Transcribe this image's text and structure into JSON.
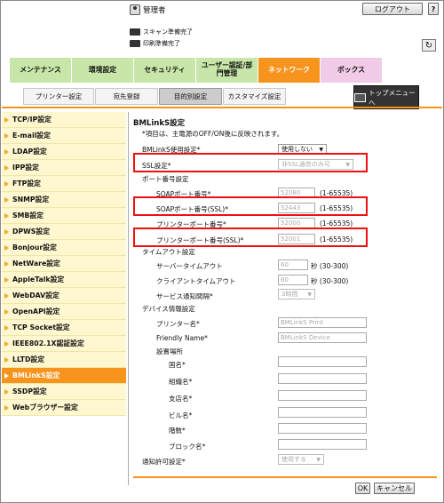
{
  "header": {
    "user": "管理者",
    "logout": "ログアウト",
    "help": "?",
    "status": [
      "スキャン準備完了",
      "印刷準備完了"
    ]
  },
  "tabs_main": [
    {
      "label": "メンテナンス",
      "color": "#c8e6a8"
    },
    {
      "label": "環境設定",
      "color": "#c8e6a8"
    },
    {
      "label": "セキュリティ",
      "color": "#c8e6a8"
    },
    {
      "label": "ユーザー認証/部門管理",
      "color": "#c8e6a8"
    },
    {
      "label": "ネットワーク",
      "color": "#f7941d"
    },
    {
      "label": "ボックス",
      "color": "#f1cbe8"
    }
  ],
  "tabs_sub": [
    "プリンター設定",
    "宛先登録",
    "目的別設定",
    "カスタマイズ設定"
  ],
  "topmenu": "トップメニューへ",
  "sidebar": [
    "TCP/IP設定",
    "E-mail設定",
    "LDAP設定",
    "IPP設定",
    "FTP設定",
    "SNMP設定",
    "SMB設定",
    "DPWS設定",
    "Bonjour設定",
    "NetWare設定",
    "AppleTalk設定",
    "WebDAV設定",
    "OpenAPI設定",
    "TCP Socket設定",
    "IEEE802.1X認証設定",
    "LLTD設定",
    "BMLinkS設定",
    "SSDP設定",
    "Webブラウザー設定"
  ],
  "form": {
    "title": "BMLinkS設定",
    "note": "*項目は、主電源のOFF/ON後に反映されます。",
    "use_label": "BMLinkS使用設定*",
    "use_value": "使用しない",
    "ssl_label": "SSL設定*",
    "ssl_value": "非SSL通信のみ可",
    "port_section": "ポート番号設定",
    "soap_label": "SOAPポート番号*",
    "soap_value": "52080",
    "soap_range": "(1-65535)",
    "soap_ssl_label": "SOAPポート番号(SSL)*",
    "soap_ssl_value": "52443",
    "soap_ssl_range": "(1-65535)",
    "printer_port_label": "プリンターポート番号*",
    "printer_port_value": "52000",
    "printer_port_range": "(1-65535)",
    "printer_ssl_label": "プリンターポート番号(SSL)*",
    "printer_ssl_value": "52001",
    "printer_ssl_range": "(1-65535)",
    "timeout_section": "タイムアウト設定",
    "server_to_label": "サーバータイムアウト",
    "server_to_value": "60",
    "server_to_range": "秒 (30-300)",
    "client_to_label": "クライアントタイムアウト",
    "client_to_value": "60",
    "client_to_range": "秒 (30-300)",
    "notify_label": "サービス通知間隔*",
    "notify_value": "3時間",
    "device_section": "デバイス情報設定",
    "printer_name_label": "プリンター名*",
    "printer_name_value": "BMLinkS Print",
    "friendly_label": "Friendly Name*",
    "friendly_value": "BMLinkS Device",
    "location_label": "設置場所",
    "country_label": "国名*",
    "org_label": "組織名*",
    "branch_label": "支店名*",
    "building_label": "ビル名*",
    "floor_label": "階数*",
    "block_label": "ブロック名*",
    "notify_permit_label": "通知許可設定*",
    "notify_permit_value": "使用する",
    "ok": "OK",
    "cancel": "キャンセル"
  }
}
